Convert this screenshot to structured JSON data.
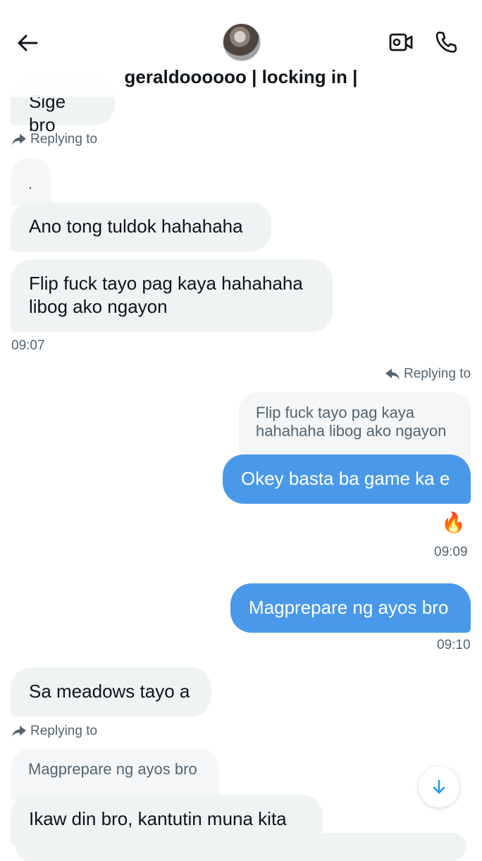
{
  "header": {
    "title": "geraldoooooo | locking in |"
  },
  "messages": {
    "m0": "Sige bro",
    "reply_label": "Replying to",
    "dot": ".",
    "m1": "Ano tong tuldok hahahaha",
    "m2_line1": "Flip fuck tayo pag kaya hahahaha",
    "m2_line2": "libog ako ngayon",
    "t1": "09:07",
    "q1_line1": "Flip fuck tayo pag kaya",
    "q1_line2": "hahahaha libog ako ngayon",
    "m3": "Okey basta ba game ka e",
    "reaction": "🔥",
    "t2": "09:09",
    "m4": "Magprepare ng ayos bro",
    "t3": "09:10",
    "m5": "Sa meadows tayo a",
    "q2": "Magprepare ng ayos bro",
    "m6": "Ikaw din bro, kantutin muna kita"
  },
  "colors": {
    "outgoing_bubble": "#4a99e9",
    "incoming_bubble": "#eff3f4",
    "muted_text": "#536471",
    "scroll_arrow": "#1d9bf0"
  },
  "icons": [
    "back-arrow-icon",
    "video-camera-icon",
    "phone-icon",
    "reply-arrow-icon",
    "arrow-down-icon"
  ]
}
